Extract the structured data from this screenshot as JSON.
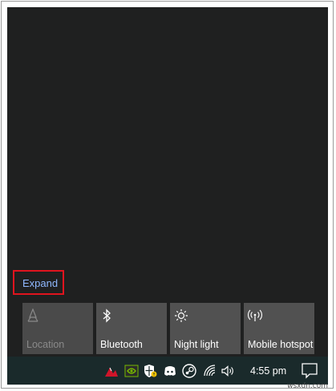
{
  "action_center": {
    "expand_label": "Expand",
    "quick_actions": [
      {
        "label": "Location",
        "icon": "location-icon",
        "state": "off"
      },
      {
        "label": "Bluetooth",
        "icon": "bluetooth-icon",
        "state": "on"
      },
      {
        "label": "Night light",
        "icon": "brightness-icon",
        "state": "on"
      },
      {
        "label": "Mobile hotspot",
        "icon": "hotspot-icon",
        "state": "on"
      }
    ]
  },
  "taskbar": {
    "clock": "4:55 pm",
    "tray_icons": [
      "eset-icon",
      "nvidia-icon",
      "windows-security-icon",
      "discord-icon",
      "steam-icon",
      "wifi-icon",
      "volume-icon"
    ]
  },
  "watermark": "wsxdn.com",
  "colors": {
    "panel_bg": "#1f2020",
    "tile_on": "#515151",
    "tile_off": "#4a4a4a",
    "link": "#8fb8ff",
    "highlight": "#e0141e"
  }
}
